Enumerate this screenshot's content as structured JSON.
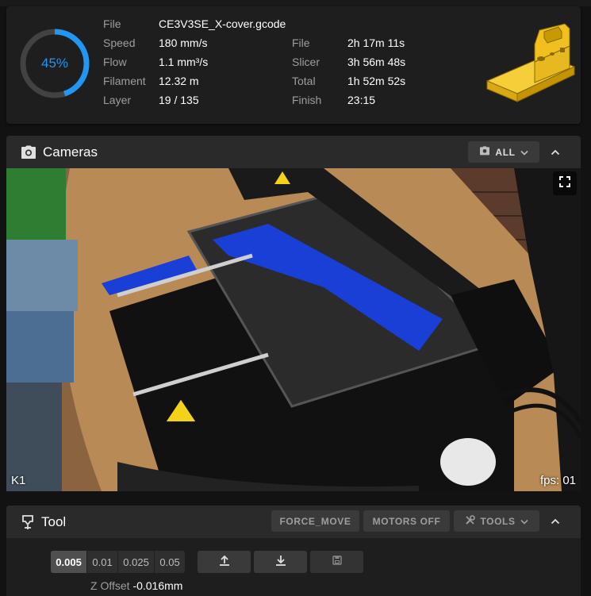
{
  "status": {
    "progress_percent": 45,
    "progress_label": "45%",
    "ring_color": "#2196f3",
    "left_stats": [
      {
        "label": "File",
        "value": "CE3V3SE_X-cover.gcode"
      },
      {
        "label": "Speed",
        "value": "180 mm/s"
      },
      {
        "label": "Flow",
        "value": "1.1 mm³/s"
      },
      {
        "label": "Filament",
        "value": "12.32 m"
      },
      {
        "label": "Layer",
        "value": "19 / 135"
      }
    ],
    "right_stats": [
      {
        "label": "File",
        "value": "2h 17m 11s"
      },
      {
        "label": "Slicer",
        "value": "3h 56m 48s"
      },
      {
        "label": "Total",
        "value": "1h 52m 52s"
      },
      {
        "label": "Finish",
        "value": "23:15"
      }
    ],
    "thumbnail_color": "#f2c01e"
  },
  "cameras": {
    "title": "Cameras",
    "all_button": "ALL",
    "camera_name": "K1",
    "fps_text": "fps: 01"
  },
  "tool": {
    "title": "Tool",
    "buttons": {
      "force_move": "FORCE_MOVE",
      "motors_off": "MOTORS OFF",
      "tools": "TOOLS"
    },
    "z_steps": [
      "0.005",
      "0.01",
      "0.025",
      "0.05"
    ],
    "z_offset_label": "Z Offset",
    "z_offset_value": "-0.016mm"
  }
}
